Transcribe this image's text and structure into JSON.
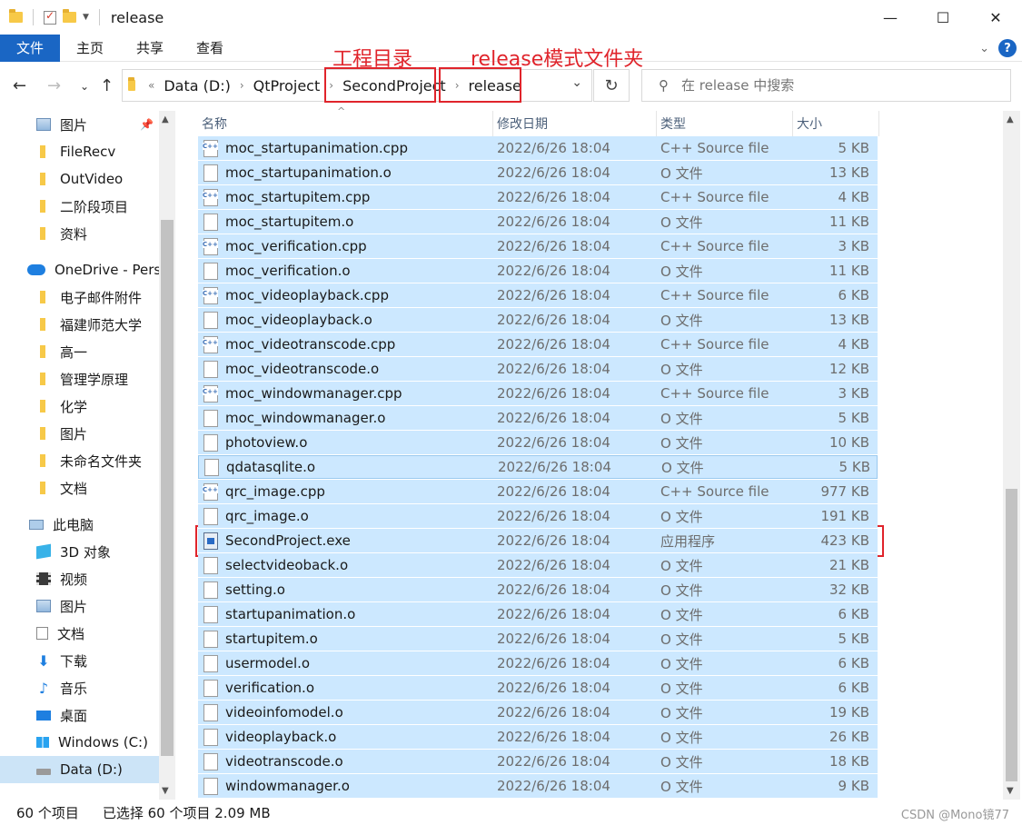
{
  "window": {
    "title": "release",
    "controls": [
      "—",
      "☐",
      "✕"
    ]
  },
  "ribbon": {
    "tabs": [
      "文件",
      "主页",
      "共享",
      "查看"
    ]
  },
  "address": {
    "overflow": "«",
    "crumbs": [
      "Data (D:)",
      "QtProject",
      "SecondProject",
      "release"
    ],
    "search_placeholder": "在 release 中搜索"
  },
  "annotations": {
    "project_dir": "工程目录",
    "release_folder": "release模式文件夹"
  },
  "sidebar": {
    "items": [
      {
        "label": "图片",
        "icon": "picture-icon",
        "pinned": true
      },
      {
        "label": "FileRecv",
        "icon": "folder-icon"
      },
      {
        "label": "OutVideo",
        "icon": "folder-icon"
      },
      {
        "label": "二阶段项目",
        "icon": "folder-icon"
      },
      {
        "label": "资料",
        "icon": "folder-icon"
      },
      {
        "label": "OneDrive - Perso",
        "icon": "onedrive-icon"
      },
      {
        "label": "电子邮件附件",
        "icon": "folder-icon"
      },
      {
        "label": "福建师范大学",
        "icon": "folder-icon"
      },
      {
        "label": "高一",
        "icon": "folder-icon"
      },
      {
        "label": "管理学原理",
        "icon": "folder-icon"
      },
      {
        "label": "化学",
        "icon": "folder-icon"
      },
      {
        "label": "图片",
        "icon": "folder-icon"
      },
      {
        "label": "未命名文件夹",
        "icon": "folder-icon"
      },
      {
        "label": "文档",
        "icon": "folder-icon"
      },
      {
        "label": "此电脑",
        "icon": "this-pc-icon"
      },
      {
        "label": "3D 对象",
        "icon": "3d-objects-icon"
      },
      {
        "label": "视频",
        "icon": "video-icon"
      },
      {
        "label": "图片",
        "icon": "picture-icon"
      },
      {
        "label": "文档",
        "icon": "document-icon"
      },
      {
        "label": "下载",
        "icon": "download-icon"
      },
      {
        "label": "音乐",
        "icon": "music-icon"
      },
      {
        "label": "桌面",
        "icon": "desktop-icon"
      },
      {
        "label": "Windows (C:)",
        "icon": "windows-drive-icon"
      },
      {
        "label": "Data (D:)",
        "icon": "drive-icon",
        "selected": true
      }
    ]
  },
  "columns": {
    "name": "名称",
    "date": "修改日期",
    "type": "类型",
    "size": "大小"
  },
  "files": [
    {
      "name": "moc_startupanimation.cpp",
      "date": "2022/6/26 18:04",
      "type": "C++ Source file",
      "size": "5 KB",
      "icon": "cpp"
    },
    {
      "name": "moc_startupanimation.o",
      "date": "2022/6/26 18:04",
      "type": "O 文件",
      "size": "13 KB",
      "icon": "o"
    },
    {
      "name": "moc_startupitem.cpp",
      "date": "2022/6/26 18:04",
      "type": "C++ Source file",
      "size": "4 KB",
      "icon": "cpp"
    },
    {
      "name": "moc_startupitem.o",
      "date": "2022/6/26 18:04",
      "type": "O 文件",
      "size": "11 KB",
      "icon": "o"
    },
    {
      "name": "moc_verification.cpp",
      "date": "2022/6/26 18:04",
      "type": "C++ Source file",
      "size": "3 KB",
      "icon": "cpp"
    },
    {
      "name": "moc_verification.o",
      "date": "2022/6/26 18:04",
      "type": "O 文件",
      "size": "11 KB",
      "icon": "o"
    },
    {
      "name": "moc_videoplayback.cpp",
      "date": "2022/6/26 18:04",
      "type": "C++ Source file",
      "size": "6 KB",
      "icon": "cpp"
    },
    {
      "name": "moc_videoplayback.o",
      "date": "2022/6/26 18:04",
      "type": "O 文件",
      "size": "13 KB",
      "icon": "o"
    },
    {
      "name": "moc_videotranscode.cpp",
      "date": "2022/6/26 18:04",
      "type": "C++ Source file",
      "size": "4 KB",
      "icon": "cpp"
    },
    {
      "name": "moc_videotranscode.o",
      "date": "2022/6/26 18:04",
      "type": "O 文件",
      "size": "12 KB",
      "icon": "o"
    },
    {
      "name": "moc_windowmanager.cpp",
      "date": "2022/6/26 18:04",
      "type": "C++ Source file",
      "size": "3 KB",
      "icon": "cpp"
    },
    {
      "name": "moc_windowmanager.o",
      "date": "2022/6/26 18:04",
      "type": "O 文件",
      "size": "5 KB",
      "icon": "o"
    },
    {
      "name": "photoview.o",
      "date": "2022/6/26 18:04",
      "type": "O 文件",
      "size": "10 KB",
      "icon": "o"
    },
    {
      "name": "qdatasqlite.o",
      "date": "2022/6/26 18:04",
      "type": "O 文件",
      "size": "5 KB",
      "icon": "o",
      "focus": true
    },
    {
      "name": "qrc_image.cpp",
      "date": "2022/6/26 18:04",
      "type": "C++ Source file",
      "size": "977 KB",
      "icon": "cpp"
    },
    {
      "name": "qrc_image.o",
      "date": "2022/6/26 18:04",
      "type": "O 文件",
      "size": "191 KB",
      "icon": "o"
    },
    {
      "name": "SecondProject.exe",
      "date": "2022/6/26 18:04",
      "type": "应用程序",
      "size": "423 KB",
      "icon": "exe"
    },
    {
      "name": "selectvideoback.o",
      "date": "2022/6/26 18:04",
      "type": "O 文件",
      "size": "21 KB",
      "icon": "o"
    },
    {
      "name": "setting.o",
      "date": "2022/6/26 18:04",
      "type": "O 文件",
      "size": "32 KB",
      "icon": "o"
    },
    {
      "name": "startupanimation.o",
      "date": "2022/6/26 18:04",
      "type": "O 文件",
      "size": "6 KB",
      "icon": "o"
    },
    {
      "name": "startupitem.o",
      "date": "2022/6/26 18:04",
      "type": "O 文件",
      "size": "5 KB",
      "icon": "o"
    },
    {
      "name": "usermodel.o",
      "date": "2022/6/26 18:04",
      "type": "O 文件",
      "size": "6 KB",
      "icon": "o"
    },
    {
      "name": "verification.o",
      "date": "2022/6/26 18:04",
      "type": "O 文件",
      "size": "6 KB",
      "icon": "o"
    },
    {
      "name": "videoinfomodel.o",
      "date": "2022/6/26 18:04",
      "type": "O 文件",
      "size": "19 KB",
      "icon": "o"
    },
    {
      "name": "videoplayback.o",
      "date": "2022/6/26 18:04",
      "type": "O 文件",
      "size": "26 KB",
      "icon": "o"
    },
    {
      "name": "videotranscode.o",
      "date": "2022/6/26 18:04",
      "type": "O 文件",
      "size": "18 KB",
      "icon": "o"
    },
    {
      "name": "windowmanager.o",
      "date": "2022/6/26 18:04",
      "type": "O 文件",
      "size": "9 KB",
      "icon": "o"
    }
  ],
  "status": {
    "count": "60 个项目",
    "selected": "已选择 60 个项目  2.09 MB",
    "watermark": "CSDN @Mono镜77"
  },
  "colors": {
    "accent": "#1a66c4",
    "selection": "#cce8ff",
    "annotation_red": "#e0242b"
  }
}
